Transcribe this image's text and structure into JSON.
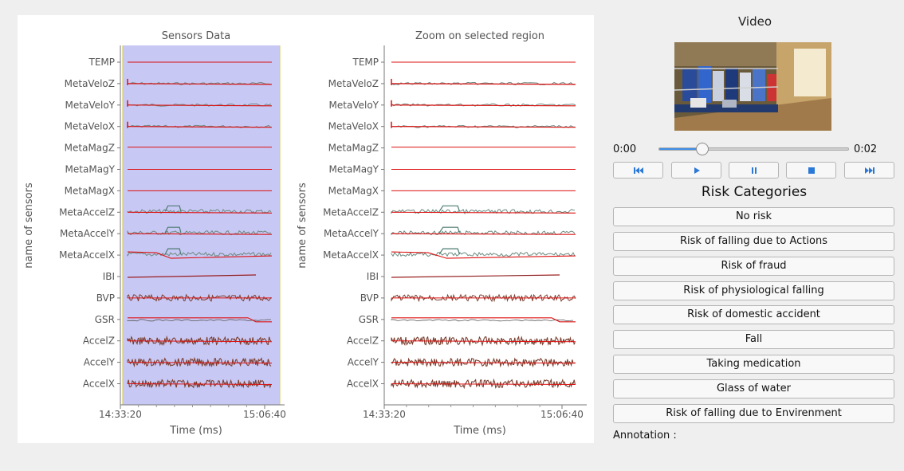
{
  "plot_left": {
    "title": "Sensors Data",
    "ylabel": "name of sensors",
    "xlabel": "Time (ms)",
    "x_ticks": [
      "14:33:20",
      "15:06:40"
    ]
  },
  "plot_right": {
    "title": "Zoom on selected region",
    "ylabel": "name of sensors",
    "xlabel": "Time (ms)",
    "x_ticks": [
      "14:33:20",
      "15:06:40"
    ]
  },
  "sensors": [
    "TEMP",
    "MetaVeloZ",
    "MetaVeloY",
    "MetaVeloX",
    "MetaMagZ",
    "MetaMagY",
    "MetaMagX",
    "MetaAccelZ",
    "MetaAccelY",
    "MetaAccelX",
    "IBI",
    "BVP",
    "GSR",
    "AccelZ",
    "AccelY",
    "AccelX"
  ],
  "video": {
    "title": "Video",
    "time_start": "0:00",
    "time_end": "0:02",
    "progress": 0.23
  },
  "controls": [
    {
      "name": "skip-back-icon",
      "glyph": "⏮"
    },
    {
      "name": "play-icon",
      "glyph": "▶"
    },
    {
      "name": "pause-icon",
      "glyph": "⏸"
    },
    {
      "name": "stop-icon",
      "glyph": "⏹"
    },
    {
      "name": "skip-forward-icon",
      "glyph": "⏭"
    }
  ],
  "risk": {
    "title": "Risk Categories",
    "buttons": [
      "No risk",
      "Risk of falling due to Actions",
      "Risk of fraud",
      "Risk of physiological falling",
      "Risk of domestic accident",
      "Fall",
      "Taking medication",
      "Glass of water",
      "Risk of falling due to Envirenment"
    ]
  },
  "annotation_label": "Annotation :",
  "colors": {
    "selection": "#c8c8f5",
    "selection_edge": "#d8cf6a",
    "signal_red": "#dd1111",
    "signal_gray": "#6a8a80",
    "signal_brown": "#7a4030",
    "control_icon": "#2a78d8"
  }
}
